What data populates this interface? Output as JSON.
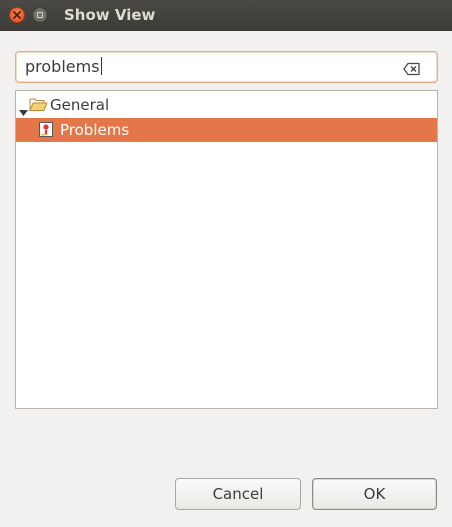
{
  "window": {
    "title": "Show View",
    "close_icon": "close-icon",
    "maximize_icon": "maximize-icon"
  },
  "search": {
    "value": "problems",
    "clear_icon": "clear-text-icon"
  },
  "tree": {
    "categories": [
      {
        "label": "General",
        "expanded": true,
        "icon": "folder-open-icon",
        "children": [
          {
            "label": "Problems",
            "icon": "problems-view-icon",
            "selected": true
          }
        ]
      }
    ]
  },
  "buttons": {
    "cancel_label": "Cancel",
    "ok_label": "OK"
  },
  "colors": {
    "selection": "#e4774a",
    "titlebar": "#3c3b37",
    "close_button": "#df4a16"
  }
}
